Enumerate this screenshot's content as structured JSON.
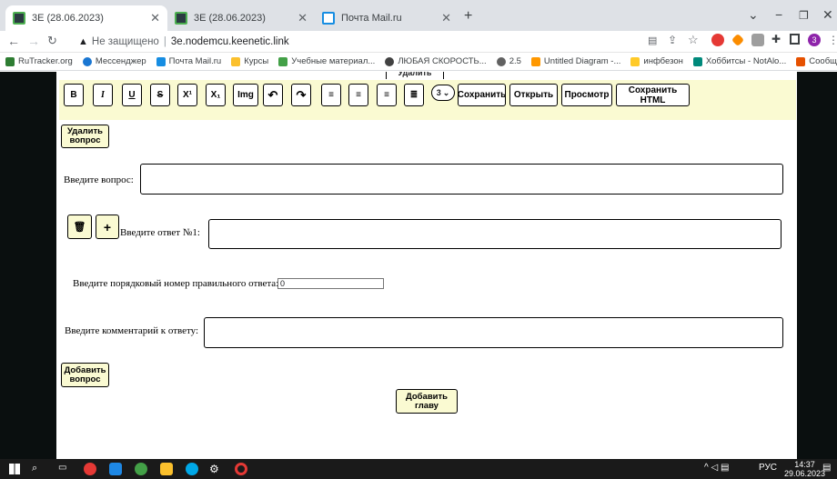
{
  "browser": {
    "tabs": [
      {
        "title": "3E (28.06.2023)",
        "active": true,
        "favicon": "app-favicon"
      },
      {
        "title": "3E (28.06.2023)",
        "active": false,
        "favicon": "app-favicon"
      },
      {
        "title": "Почта Mail.ru",
        "active": false,
        "favicon": "mail-favicon"
      }
    ],
    "address": {
      "warning": "Не защищено",
      "url": "3e.nodemcu.keenetic.link"
    },
    "bookmarks": [
      "RuTracker.org",
      "Мессенджер",
      "Почта Mail.ru",
      "Курсы",
      "Учебные материал...",
      "ЛЮБАЯ СКОРОСТЬ...",
      "2.5",
      "Untitled Diagram -...",
      "инфбезон",
      "Хоббитсы - NotAlo...",
      "Сообщения"
    ],
    "profile_badge": "3"
  },
  "editor": {
    "clipped_label": "Удалить",
    "toolbar": {
      "bold": "B",
      "italic": "I",
      "underline": "U",
      "strike": "S",
      "superscript": "X¹",
      "subscript": "X₁",
      "img": "Img",
      "undo": "↶",
      "redo": "↷",
      "align_left": "≡",
      "align_center": "≡",
      "align_right": "≡",
      "justify": "≣",
      "size": "3",
      "save": "Сохранить",
      "open": "Открыть",
      "preview": "Просмотр",
      "save_html": "Сохранить HTML"
    },
    "delete_question": "Удалить вопрос",
    "question_label": "Введите вопрос:",
    "delete_answer_icon": "🗑",
    "add_answer": "+",
    "answer_label": "Введите ответ №1:",
    "correct_label": "Введите порядковый номер правильного ответа:",
    "correct_value": "0",
    "comment_label": "Введите комментарий к ответу:",
    "add_question": "Добавить вопрос",
    "add_chapter": "Добавить главу"
  },
  "taskbar": {
    "lang": "РУС",
    "time": "14:37",
    "date": "29.06.2023"
  }
}
